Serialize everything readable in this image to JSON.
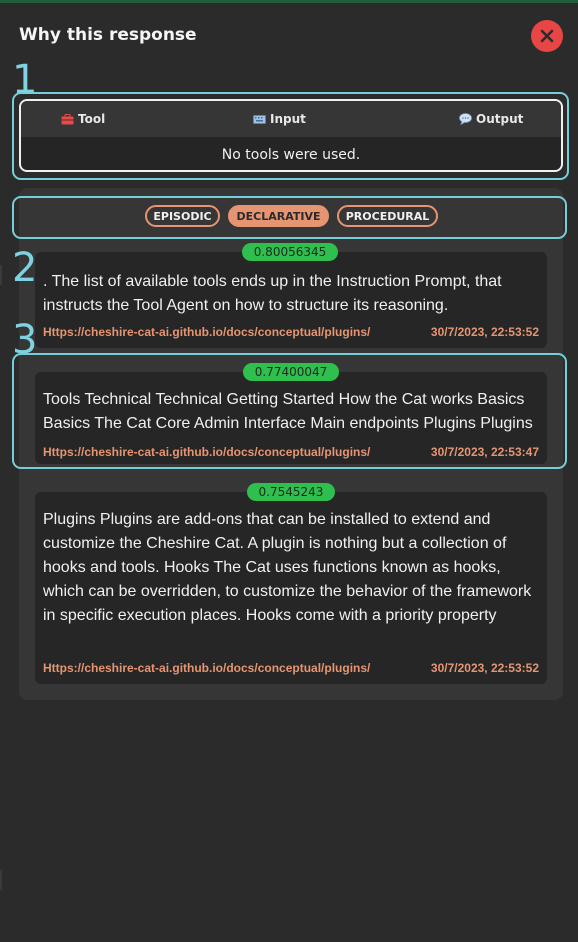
{
  "panel": {
    "title": "Why this response",
    "close_icon": "close-icon"
  },
  "annotations": [
    "1",
    "2",
    "3"
  ],
  "tools": {
    "headers": [
      {
        "icon": "toolbox-icon",
        "label": "Tool"
      },
      {
        "icon": "keyboard-icon",
        "label": "Input"
      },
      {
        "icon": "speech-bubble-icon",
        "label": "Output"
      }
    ],
    "empty_message": "No tools were used."
  },
  "memory_tabs": [
    {
      "label": "EPISODIC",
      "active": false
    },
    {
      "label": "DECLARATIVE",
      "active": true
    },
    {
      "label": "PROCEDURAL",
      "active": false
    }
  ],
  "memories": [
    {
      "score": "0.80056345",
      "text": ". The list of available tools ends up in the Instruction Prompt, that instructs the Tool Agent on how to structure its reasoning.",
      "source": "Https://cheshire-cat-ai.github.io/docs/conceptual/plugins/",
      "timestamp": "30/7/2023, 22:53:52"
    },
    {
      "score": "0.77400047",
      "text": "Tools Technical Technical Getting Started How the Cat works Basics Basics The Cat Core Admin Interface Main endpoints Plugins Plugins",
      "source": "Https://cheshire-cat-ai.github.io/docs/conceptual/plugins/",
      "timestamp": "30/7/2023, 22:53:47"
    },
    {
      "score": "0.7545243",
      "text": "Plugins Plugins are add-ons that can be installed to extend and customize the Cheshire Cat. A plugin is nothing but a collection of hooks and tools. Hooks The Cat uses functions known as hooks, which can be overridden, to customize the behavior of the framework in specific execution places. Hooks come with a priority property",
      "source": "Https://cheshire-cat-ai.github.io/docs/conceptual/plugins/",
      "timestamp": "30/7/2023, 22:53:52"
    }
  ],
  "colors": {
    "accent": "#e59572",
    "score": "#2fbf4f",
    "annotation": "#74cfd9",
    "close": "#e84545"
  }
}
